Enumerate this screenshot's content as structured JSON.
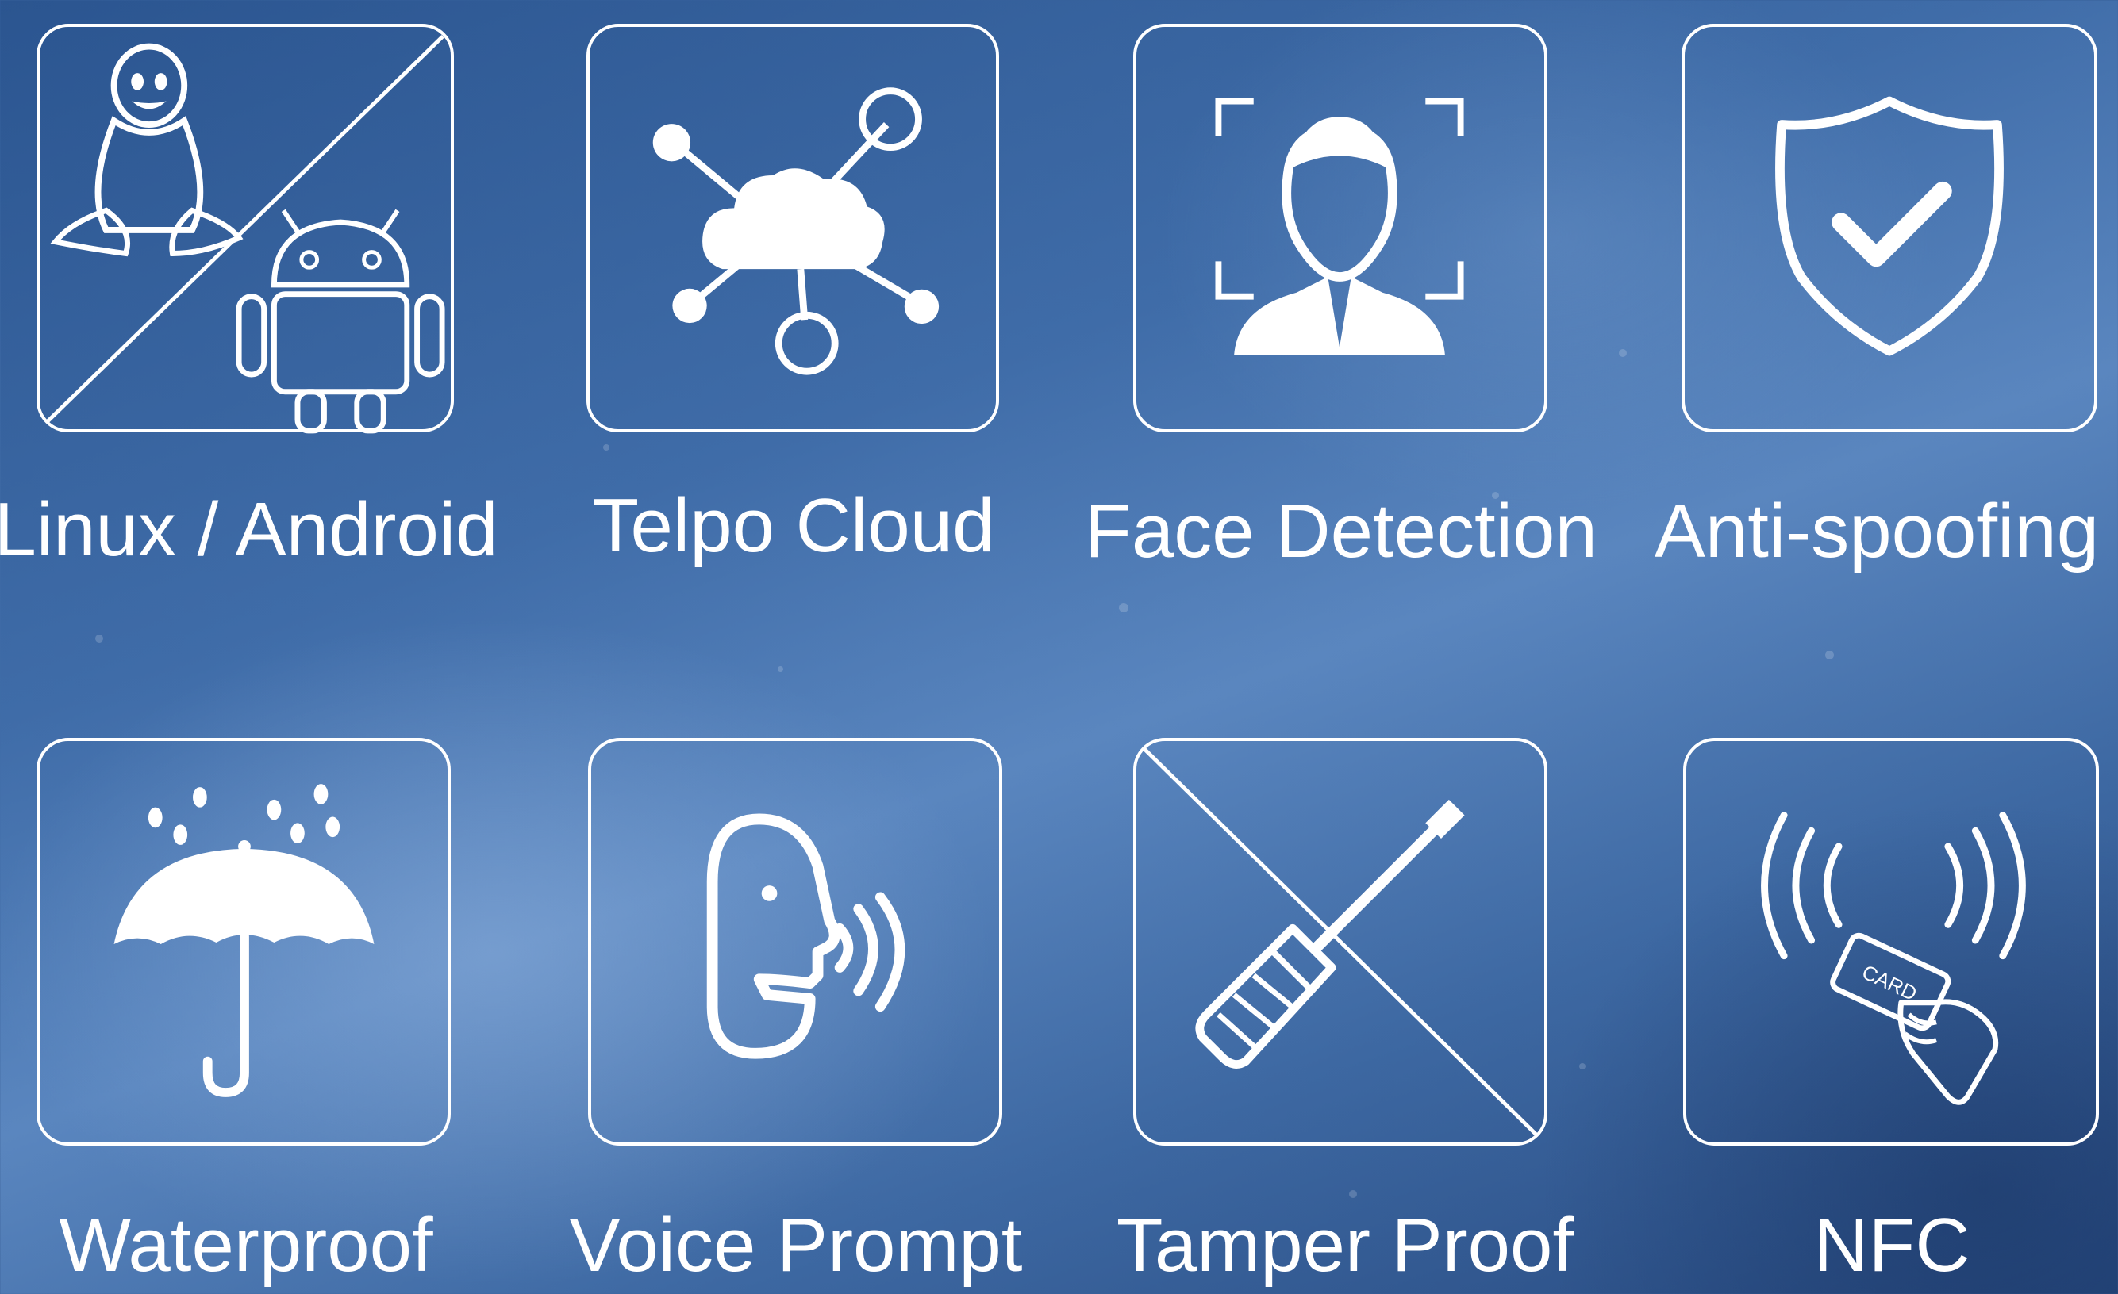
{
  "features": [
    {
      "label": "Linux / Android",
      "icon": "linux-android-icon"
    },
    {
      "label": "Telpo Cloud",
      "icon": "cloud-network-icon"
    },
    {
      "label": "Face Detection",
      "icon": "face-scan-icon"
    },
    {
      "label": "Anti-spoofing",
      "icon": "shield-check-icon"
    },
    {
      "label": "Waterproof",
      "icon": "umbrella-rain-icon"
    },
    {
      "label": "Voice Prompt",
      "icon": "speaking-head-icon"
    },
    {
      "label": "Tamper Proof",
      "icon": "no-screwdriver-icon"
    },
    {
      "label": "NFC",
      "icon": "nfc-card-icon",
      "card_text": "CARD"
    }
  ],
  "colors": {
    "icon": "#ffffff",
    "background": "#3f6ca8"
  }
}
